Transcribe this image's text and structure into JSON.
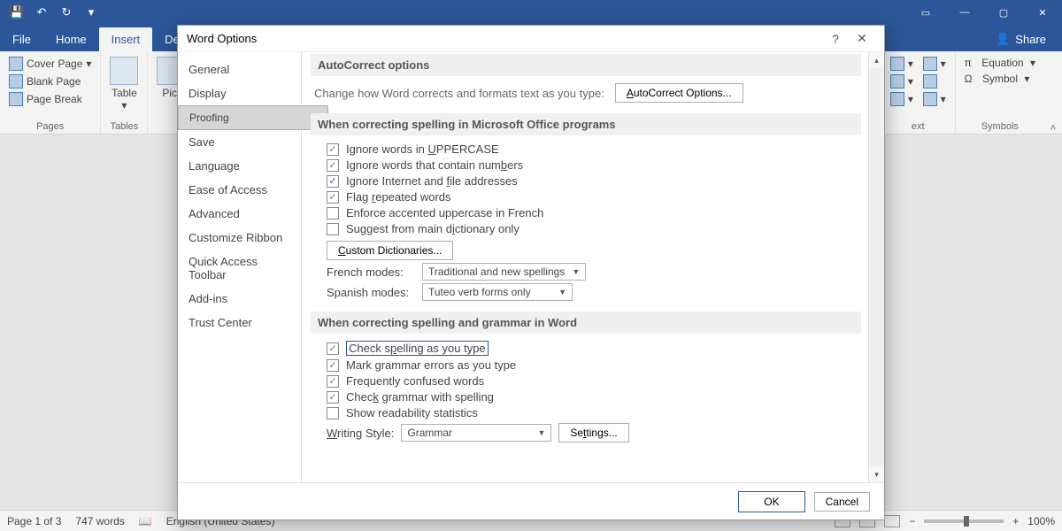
{
  "qat": {
    "save": "💾",
    "undo": "↶",
    "redo": "↻",
    "more": "▾"
  },
  "wincontrols": {
    "ribbonopts": "▭",
    "min": "—",
    "max": "▢",
    "close": "✕"
  },
  "tabs": {
    "file": "File",
    "home": "Home",
    "insert": "Insert",
    "design": "Des"
  },
  "share_label": "Share",
  "ribbon": {
    "pages": {
      "cover": "Cover Page",
      "blank": "Blank Page",
      "break": "Page Break",
      "group": "Pages"
    },
    "tables": {
      "table": "Table",
      "group": "Tables"
    },
    "illus": {
      "pict": "Pict"
    },
    "right": {
      "text": "ext",
      "equation": "Equation",
      "symbol": "Symbol",
      "group": "Symbols"
    }
  },
  "dialog": {
    "title": "Word Options",
    "help": "?",
    "close": "✕",
    "nav": [
      "General",
      "Display",
      "Proofing",
      "Save",
      "Language",
      "Ease of Access",
      "Advanced",
      "Customize Ribbon",
      "Quick Access Toolbar",
      "Add-ins",
      "Trust Center"
    ],
    "nav_selected_index": 2,
    "sec1": {
      "head": "AutoCorrect options",
      "text": "Change how Word corrects and formats text as you type:",
      "btn": "AutoCorrect Options..."
    },
    "sec2": {
      "head": "When correcting spelling in Microsoft Office programs",
      "items": [
        {
          "checked": true,
          "label_pre": "Ignore words in ",
          "label_u": "U",
          "label_post": "PPERCASE"
        },
        {
          "checked": true,
          "label_pre": "Ignore words that contain num",
          "label_u": "b",
          "label_post": "ers"
        },
        {
          "checked": true,
          "blue": true,
          "label_pre": "Ignore Internet and ",
          "label_u": "f",
          "label_post": "ile addresses"
        },
        {
          "checked": true,
          "label_pre": "Flag ",
          "label_u": "r",
          "label_post": "epeated words"
        },
        {
          "checked": false,
          "label_pre": "Enforce accented uppercase in French",
          "label_u": "",
          "label_post": ""
        },
        {
          "checked": false,
          "label_pre": "Suggest from main d",
          "label_u": "i",
          "label_post": "ctionary only"
        }
      ],
      "customdict": "Custom Dictionaries...",
      "french_label": "French modes:",
      "french_value": "Traditional and new spellings",
      "spanish_label": "Spanish modes:",
      "spanish_value": "Tuteo verb forms only"
    },
    "sec3": {
      "head": "When correcting spelling and grammar in Word",
      "items": [
        {
          "checked": true,
          "focused": true,
          "label_pre": "Check s",
          "label_u": "p",
          "label_post": "elling as you type"
        },
        {
          "checked": true,
          "label_pre": "Mark grammar errors as you type",
          "label_u": "",
          "label_post": ""
        },
        {
          "checked": true,
          "label_pre": "Frequently confused words",
          "label_u": "",
          "label_post": ""
        },
        {
          "checked": true,
          "label_pre": "Chec",
          "label_u": "k",
          "label_post": " grammar with spelling"
        },
        {
          "checked": false,
          "label_pre": "Show readability statistics",
          "label_u": "",
          "label_post": ""
        }
      ],
      "writing_label": "Writing Style:",
      "writing_value": "Grammar",
      "settings": "Settings..."
    },
    "ok": "OK",
    "cancel": "Cancel"
  },
  "status": {
    "page": "Page 1 of 3",
    "words": "747 words",
    "lang": "English (United States)",
    "zoom": "100%"
  }
}
